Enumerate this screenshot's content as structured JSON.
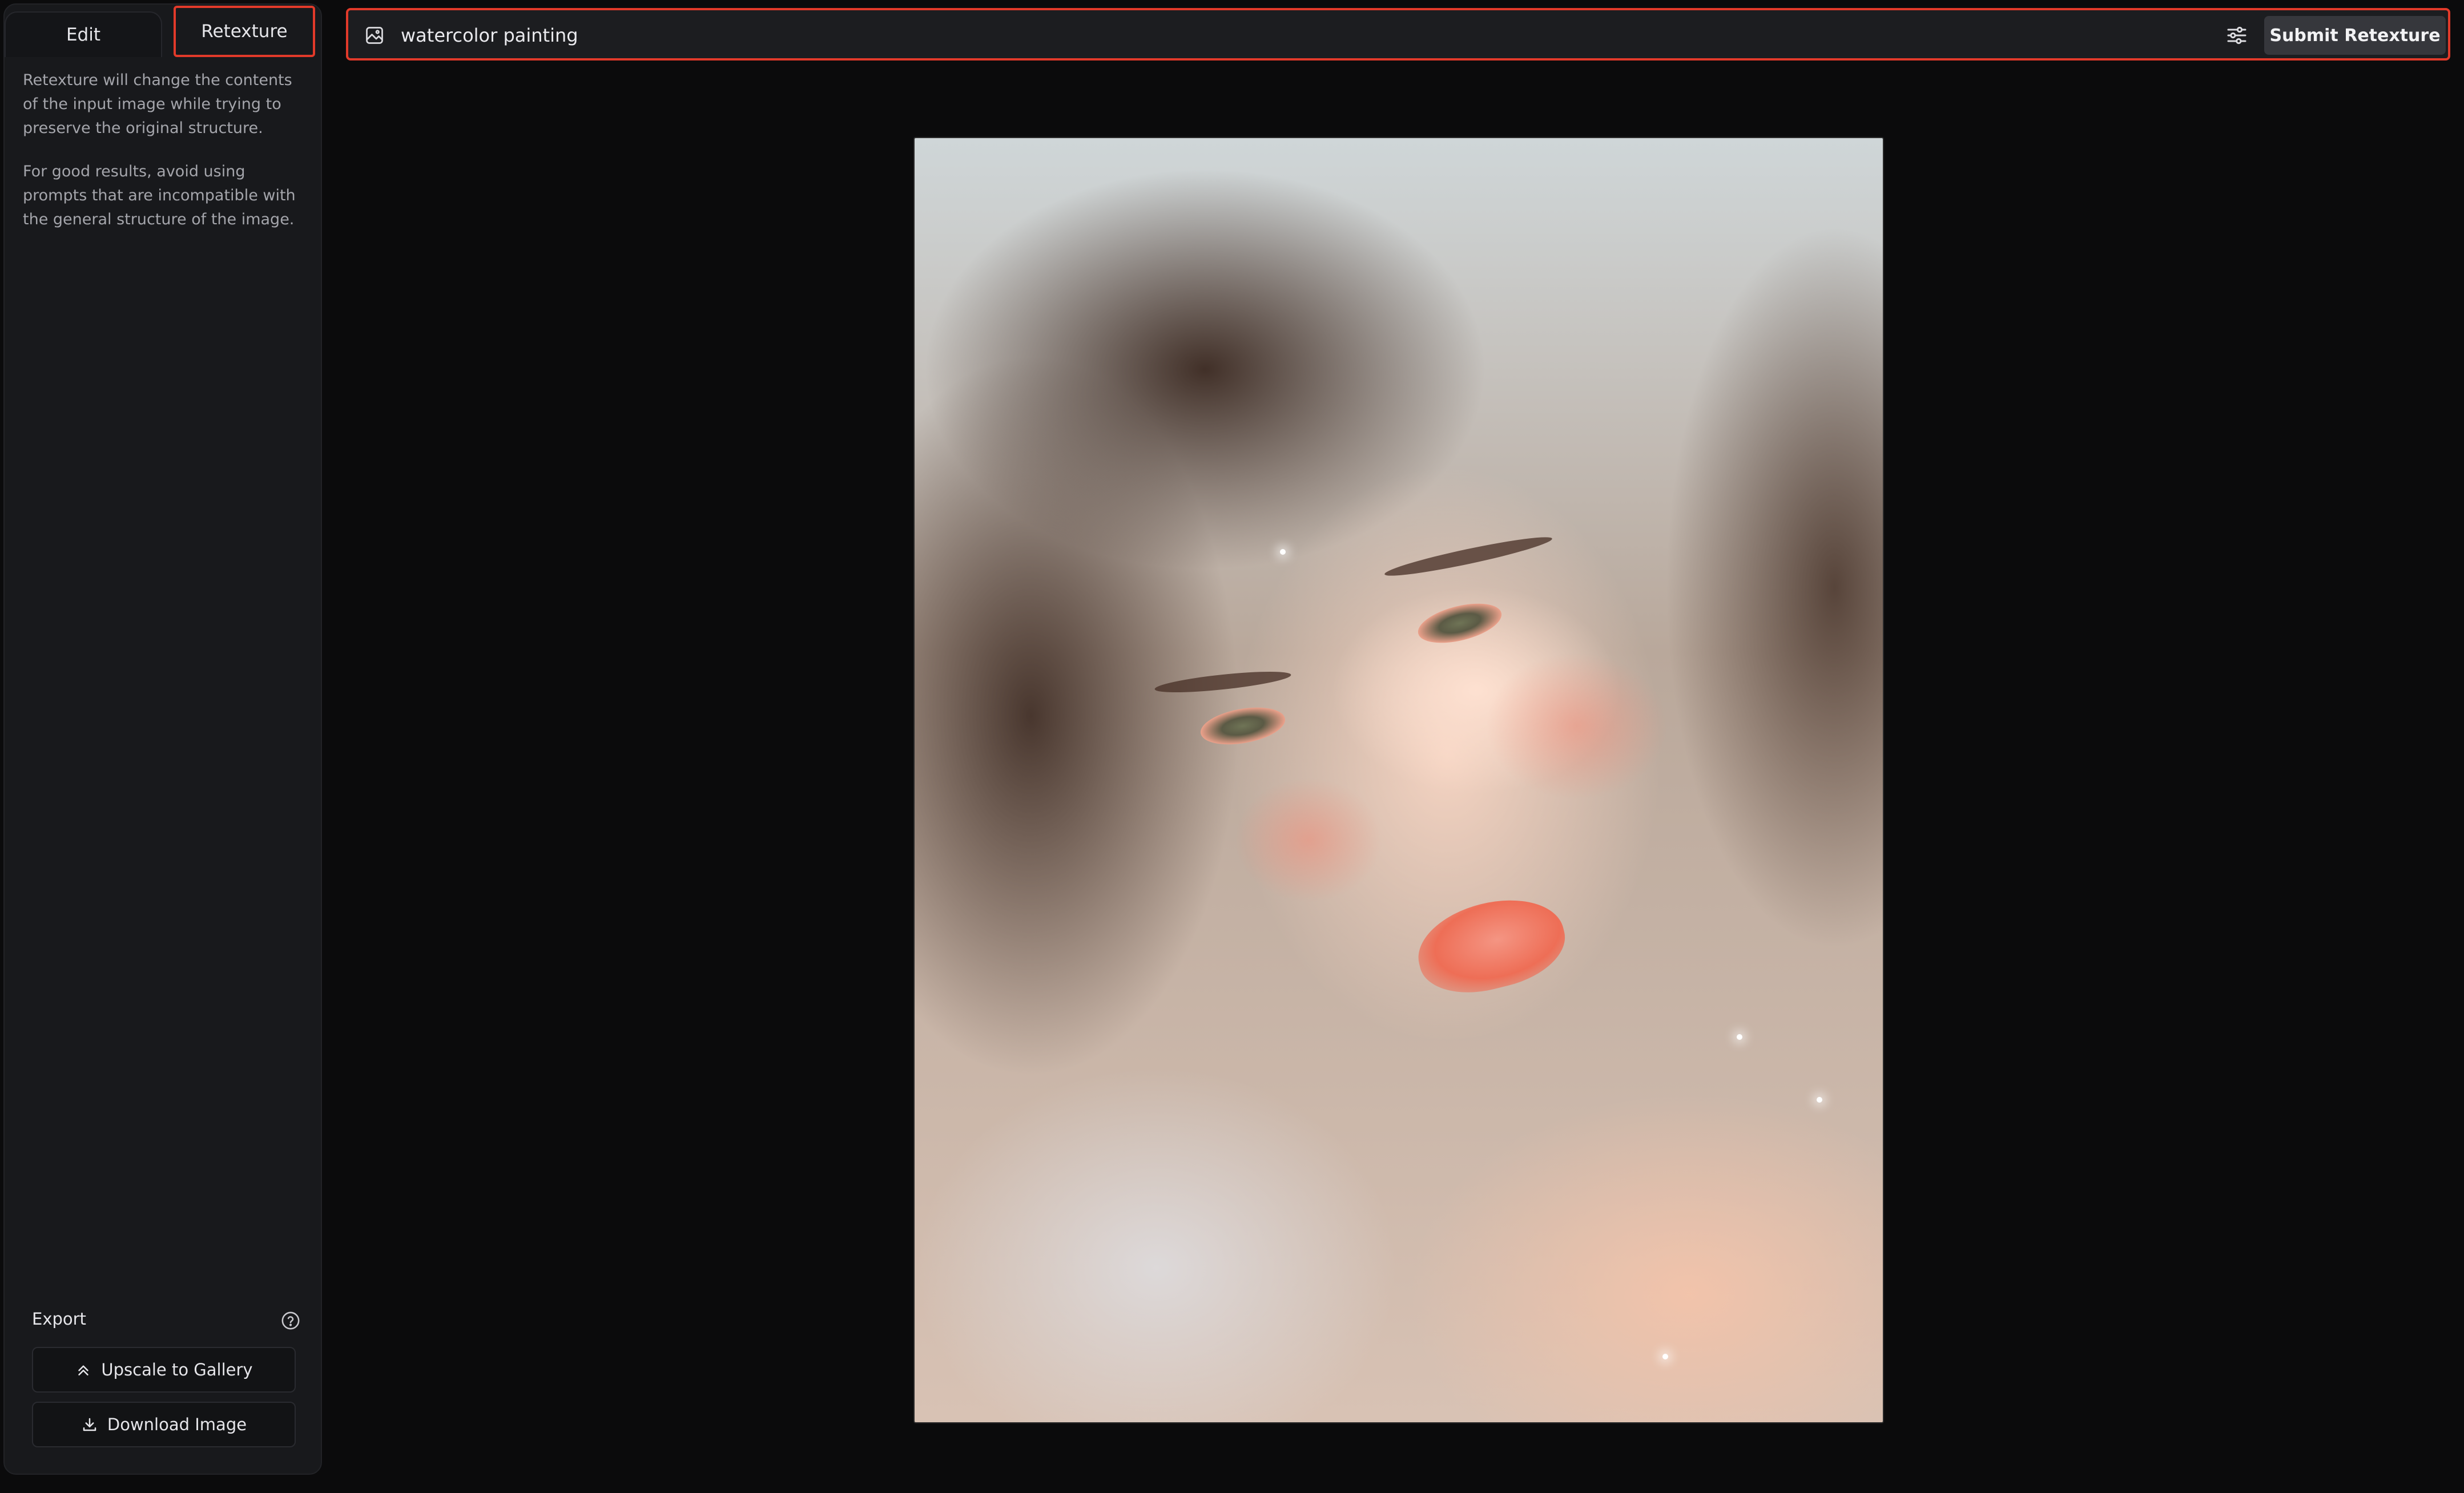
{
  "sidebar": {
    "tabs": [
      {
        "label": "Edit",
        "active": false
      },
      {
        "label": "Retexture",
        "active": true
      }
    ],
    "description": [
      "Retexture will change the contents of the input image while trying to preserve the original structure.",
      "For good results, avoid using prompts that are incompatible with the general structure of the image."
    ],
    "export": {
      "label": "Export",
      "help_icon": "help-circle-icon",
      "buttons": [
        {
          "label": "Upscale to Gallery",
          "icon": "chevrons-up-icon"
        },
        {
          "label": "Download Image",
          "icon": "download-icon"
        }
      ]
    }
  },
  "prompt_bar": {
    "icon": "image-icon",
    "value": "watercolor painting",
    "settings_icon": "sliders-icon",
    "submit_label": "Submit Retexture"
  },
  "canvas": {
    "image": "portrait-photo"
  },
  "colors": {
    "background": "#0b0b0c",
    "panel": "#18191c",
    "highlight": "#e23a2a",
    "submit_button": "#36373c",
    "muted_text": "#a4a5ab"
  }
}
